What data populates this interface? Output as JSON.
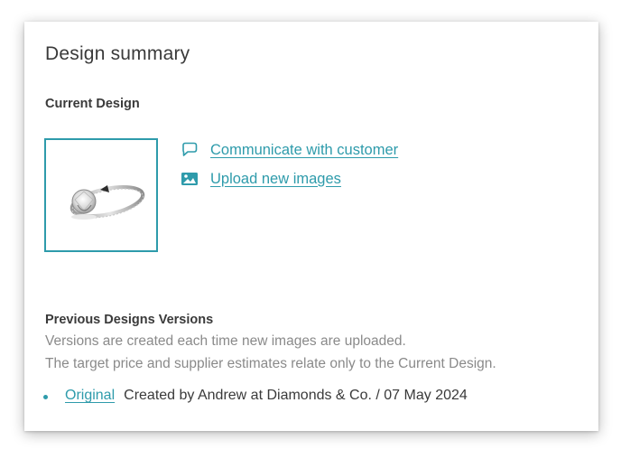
{
  "panel": {
    "title": "Design summary",
    "current_label": "Current Design",
    "previous_label": "Previous Designs Versions"
  },
  "current_design": {
    "image_icon": "ring-thumbnail",
    "actions": [
      {
        "label": "Communicate with customer",
        "icon": "speech-bubble-icon"
      },
      {
        "label": "Upload new images",
        "icon": "image-icon"
      }
    ]
  },
  "previous_designs": {
    "description_line1": "Versions are created each time new images are uploaded.",
    "description_line2": "The target price and supplier estimates relate only to the Current Design.",
    "versions": [
      {
        "link": "Original",
        "meta": "Created by Andrew at Diamonds & Co. / 07 May 2024"
      }
    ]
  },
  "colors": {
    "accent": "#2e9bab",
    "text": "#3a3a3a",
    "muted": "#8a8a8a"
  }
}
